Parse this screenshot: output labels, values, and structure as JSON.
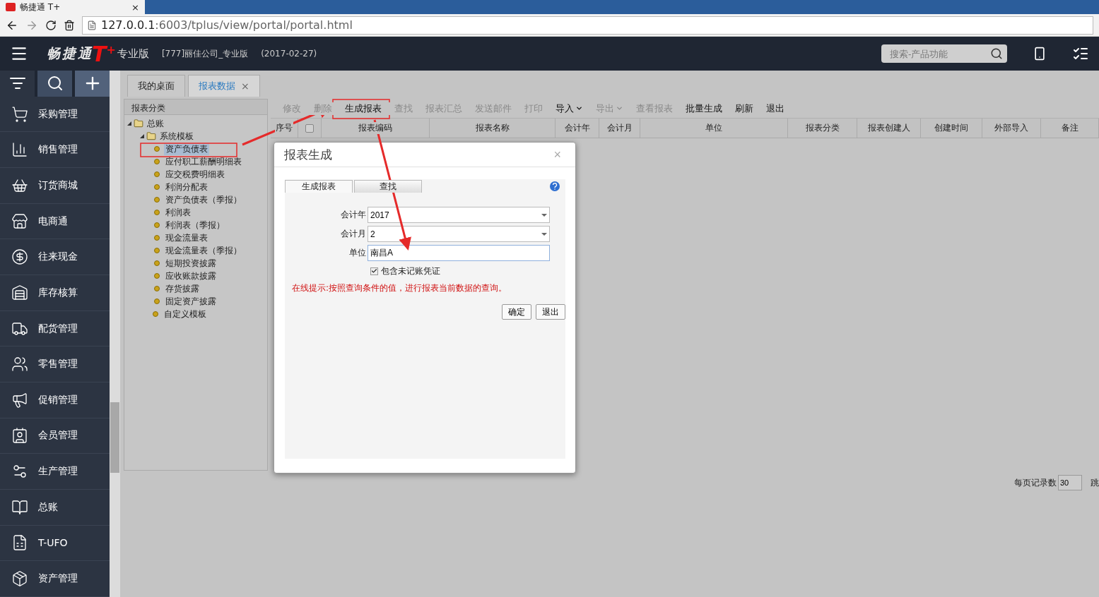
{
  "browser": {
    "tab_title": "畅捷通 T+",
    "close": "×",
    "url_host": "127.0.0.1",
    "url_path": ":6003/tplus/view/portal/portal.html"
  },
  "header": {
    "logo": "畅捷通",
    "logo_mark": "T",
    "logo_sup": "+",
    "edition": "专业版",
    "company": "[777]丽佳公司_专业版",
    "date": "(2017-02-27)",
    "search": {
      "placeholder": "搜索-产品功能"
    }
  },
  "sidebar": {
    "items": [
      {
        "label": "采购管理"
      },
      {
        "label": "销售管理"
      },
      {
        "label": "订货商城"
      },
      {
        "label": "电商通"
      },
      {
        "label": "往来现金"
      },
      {
        "label": "库存核算"
      },
      {
        "label": "配货管理"
      },
      {
        "label": "零售管理"
      },
      {
        "label": "促销管理"
      },
      {
        "label": "会员管理"
      },
      {
        "label": "生产管理"
      },
      {
        "label": "总账"
      },
      {
        "label": "T-UFO"
      },
      {
        "label": "资产管理"
      }
    ]
  },
  "tabs": [
    {
      "label": "我的桌面",
      "selected": false
    },
    {
      "label": "报表数据",
      "selected": true,
      "close": "×"
    }
  ],
  "tree": {
    "title": "报表分类",
    "items": [
      {
        "label": "总账",
        "expanded": true,
        "selected": false,
        "children": [
          {
            "label": "系统模板",
            "expanded": true,
            "selected": false,
            "children": [
              {
                "label": "资产负债表",
                "selected": true
              },
              {
                "label": "应付职工薪酬明细表",
                "selected": false
              },
              {
                "label": "应交税费明细表",
                "selected": false
              },
              {
                "label": "利润分配表",
                "selected": false
              },
              {
                "label": "资产负债表（季报）",
                "selected": false
              },
              {
                "label": "利润表",
                "selected": false
              },
              {
                "label": "利润表（季报）",
                "selected": false
              },
              {
                "label": "现金流量表",
                "selected": false
              },
              {
                "label": "现金流量表（季报）",
                "selected": false
              },
              {
                "label": "短期投资披露",
                "selected": false
              },
              {
                "label": "应收账款披露",
                "selected": false
              },
              {
                "label": "存货披露",
                "selected": false
              },
              {
                "label": "固定资产披露",
                "selected": false
              }
            ]
          },
          {
            "label": "自定义模板",
            "selected": false
          }
        ]
      }
    ]
  },
  "toolbar": [
    {
      "label": "修改",
      "disabled": true,
      "dropdown": false
    },
    {
      "label": "删除",
      "disabled": true,
      "dropdown": false
    },
    {
      "label": "生成报表",
      "disabled": false,
      "dropdown": false
    },
    {
      "label": "查找",
      "disabled": true,
      "dropdown": false
    },
    {
      "label": "报表汇总",
      "disabled": true,
      "dropdown": false
    },
    {
      "label": "发送邮件",
      "disabled": true,
      "dropdown": false
    },
    {
      "label": "打印",
      "disabled": true,
      "dropdown": false
    },
    {
      "label": "导入",
      "disabled": false,
      "dropdown": true
    },
    {
      "label": "导出",
      "disabled": true,
      "dropdown": true
    },
    {
      "label": "查看报表",
      "disabled": true,
      "dropdown": false
    },
    {
      "label": "批量生成",
      "disabled": false,
      "dropdown": false
    },
    {
      "label": "刷新",
      "disabled": false,
      "dropdown": false
    },
    {
      "label": "退出",
      "disabled": false,
      "dropdown": false
    }
  ],
  "table": {
    "columns": [
      {
        "kind": "text",
        "label": "序号"
      },
      {
        "kind": "checkbox",
        "checked": false
      },
      {
        "kind": "text",
        "label": "报表编码"
      },
      {
        "kind": "text",
        "label": "报表名称"
      },
      {
        "kind": "text",
        "label": "会计年"
      },
      {
        "kind": "text",
        "label": "会计月"
      },
      {
        "kind": "text",
        "label": "单位"
      },
      {
        "kind": "text",
        "label": "报表分类"
      },
      {
        "kind": "text",
        "label": "报表创建人"
      },
      {
        "kind": "text",
        "label": "创建时间"
      },
      {
        "kind": "text",
        "label": "外部导入"
      },
      {
        "kind": "text",
        "label": "备注"
      }
    ]
  },
  "pagination": {
    "label": "每页记录数",
    "page_size": "30",
    "jump": "跳"
  },
  "dialog": {
    "title": "报表生成",
    "close": "×",
    "tabs": [
      {
        "label": "生成报表",
        "selected": true
      },
      {
        "label": "查找",
        "selected": false
      }
    ],
    "fields": [
      {
        "kind": "select",
        "label": "会计年",
        "value": "2017"
      },
      {
        "kind": "select",
        "label": "会计月",
        "value": "2"
      },
      {
        "kind": "text",
        "label": "单位",
        "value": "南昌A",
        "focused": true
      }
    ],
    "checkbox": {
      "label": "包含未记账凭证",
      "checked": true
    },
    "hint": "在线提示:按照查询条件的值，进行报表当前数据的查询。",
    "buttons": [
      "确定",
      "退出"
    ]
  }
}
